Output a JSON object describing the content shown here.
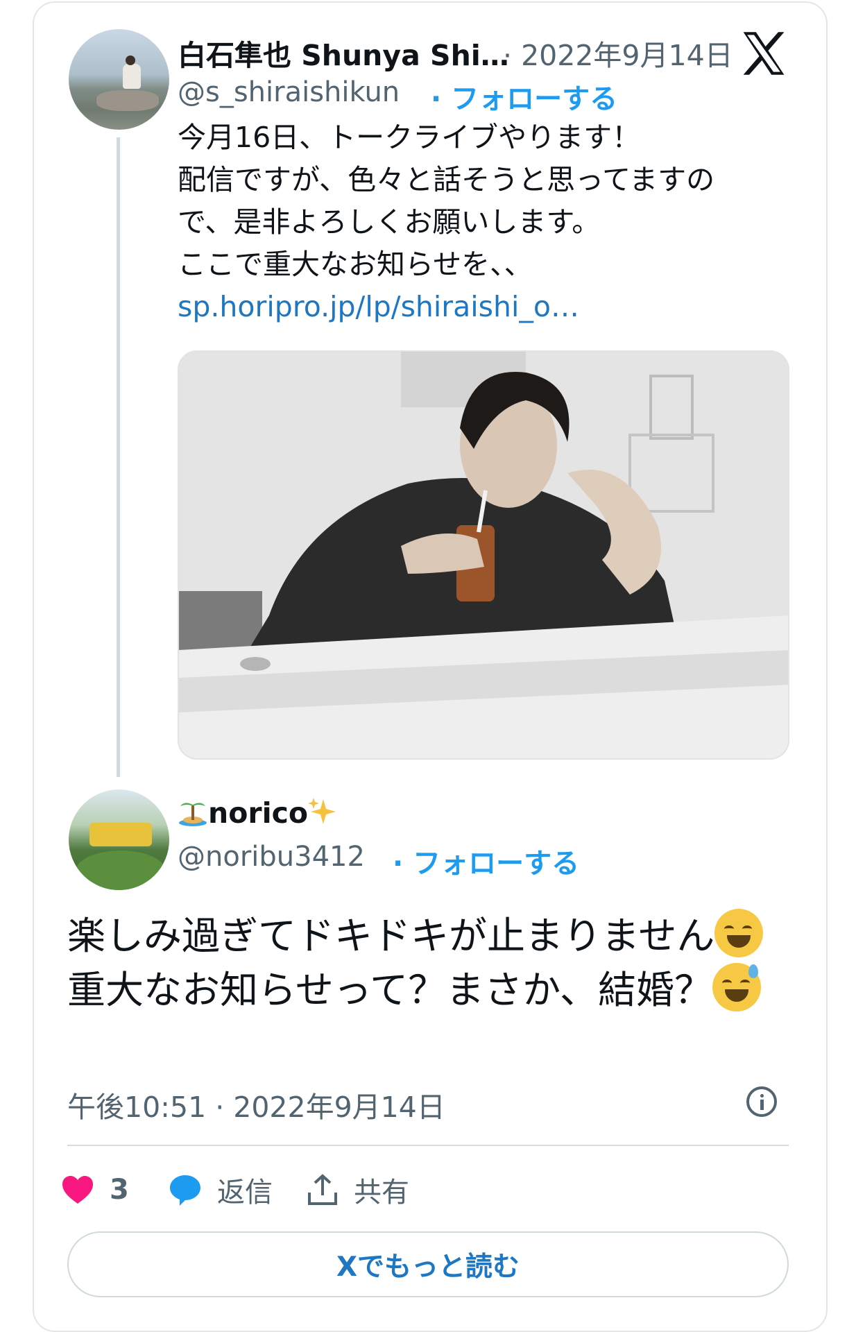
{
  "original_tweet": {
    "author_name": "白石隼也 Shunya Shi…",
    "date": "· 2022年9月14日",
    "handle": "@s_shiraishikun",
    "follow_label": "· フォローする",
    "body_lines": [
      "今月16日、トークライブやります！",
      "配信ですが、色々と話そうと思ってますの",
      "で、是非よろしくお願いします。",
      "ここで重大なお知らせを、、"
    ],
    "link": "sp.horipro.jp/lp/shiraishi_o…",
    "media_icon": "photo-man-drinking-iced-tea"
  },
  "reply_tweet": {
    "author_name": "norico",
    "name_prefix_icon": "island-emoji",
    "name_suffix_icon": "sparkles-emoji",
    "handle": "@noribu3412",
    "follow_label": "· フォローする",
    "text_part1": "楽しみ過ぎてドキドキが止まりません",
    "emoji1": "laughing-face-emoji",
    "text_part2": "重大なお知らせって？まさか、結婚？",
    "emoji2": "sweat-smile-emoji",
    "timestamp": "午後10:51 · 2022年9月14日"
  },
  "actions": {
    "like_count": "3",
    "reply_label": "返信",
    "share_label": "共有"
  },
  "read_more_label": "Xでもっと読む",
  "colors": {
    "accent": "#1d9bf0",
    "link": "#1d77c2",
    "muted": "#536471",
    "like": "#f91880"
  }
}
